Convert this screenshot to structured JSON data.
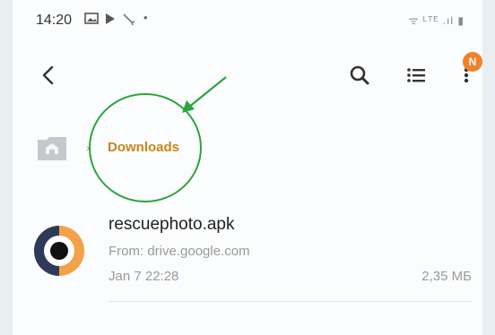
{
  "status_bar": {
    "time": "14:20",
    "left_icons": [
      "image-icon",
      "play-store-icon",
      "wrench-icon",
      "dot-icon"
    ],
    "right_indicators": "ᯤ ᴸᵀᴱ .ıl ▮"
  },
  "toolbar": {
    "back_icon": "chevron-left-icon",
    "search_icon": "search-icon",
    "list_icon": "list-view-icon",
    "more_icon": "more-vertical-icon",
    "badge": "N"
  },
  "breadcrumb": {
    "home_icon": "home-folder-icon",
    "separator": "›",
    "current": "Downloads"
  },
  "annotation": {
    "color": "#2aa63a",
    "shapes": [
      "circle",
      "arrow"
    ]
  },
  "files": [
    {
      "name": "rescuephoto.apk",
      "from": "From: drive.google.com",
      "date": "Jan 7 22:28",
      "size": "2,35 МБ",
      "icon": "app-logo-icon"
    }
  ],
  "colors": {
    "accent": "#c8871a",
    "badge": "#f0812a",
    "icon_dark": "#2d3a59"
  }
}
